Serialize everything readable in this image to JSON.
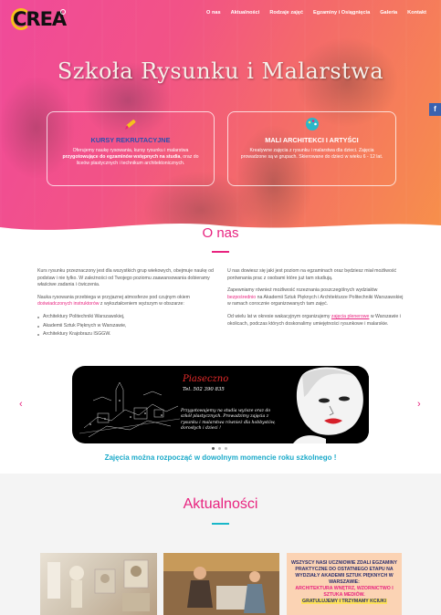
{
  "brand": {
    "logo_text": "CREA"
  },
  "nav": {
    "items": [
      "O nas",
      "Aktualności",
      "Rodzaje zajęć",
      "Egzaminy i Osiągnięcia",
      "Galeria",
      "Kontakt"
    ]
  },
  "social": {
    "facebook_label": "f"
  },
  "hero": {
    "title": "Szkoła Rysunku i Malarstwa",
    "card1": {
      "title": "KURSY REKRUTACYJNE",
      "text_a": "Oferujemy naukę rysowania, kursy rysunku i malarstwa ",
      "text_bold": "przygotowujące do egzaminów wstępnych na studia",
      "text_b": ", oraz do liceów plastycznych i technikum architektonicznych."
    },
    "card2": {
      "title": "MALI ARCHITEKCI I ARTYŚCI",
      "text": "Kreatywne zajęcia z rysunku i malarstwa dla dzieci. Zajęcia prowadzone są w grupach. Skierowane do dzieci w wieku 6 - 12 lat."
    }
  },
  "about": {
    "title": "O nas",
    "left_p1": "Kurs rysunku przeznaczony jest dla wszystkich grup wiekowych, obejmuje naukę od podstaw i nie tylko. W zależności od Twojego poziomu zaawansowania dobieramy właściwe zadania i ćwiczenia.",
    "left_p2a": "Nauka rysowania przebiega w przyjaznej atmosferze pod czujnym okiem ",
    "left_p2_link": "doświadczonych instruktorów",
    "left_p2b": " z wykształceniem wyższym w obszarze:",
    "list": [
      "Architektury Politechniki Warszawskiej,",
      "Akademii Sztuk Pięknych w Warszawie,",
      "Architektury Krajobrazu ISGGW."
    ],
    "right_p1": "U nas dowiesz się jaki jest poziom na egzaminach oraz będziesz miał możliwość porównania  prac z osobami które już tam studiują.",
    "right_p2a": "Zapewniamy również możliwość rozeznania poszczególnych wydziałów ",
    "right_p2_link": "bezpośrednio",
    "right_p2b": " na Akademii Sztuk Pięknych  i Architekturze Politechniki Warszawskiej  w ramach corocznie organizowanych tam zajęć.",
    "right_p3a": "Od wielu lat w okresie wakacyjnym organizujemy ",
    "right_p3_link": "zajęcia plenerowe",
    "right_p3b": " w Warszawie i okolicach,  podczas których doskonalimy umiejętności rysunkowe i malarskie."
  },
  "slider": {
    "prev": "‹",
    "next": "›",
    "place": "Piaseczno",
    "phone": "Tel. 502 390 835",
    "text": "Przygotowujemy na studia wyższe oraz do szkół plastycznych. Prowadzimy zajęcia z rysunku i malarstwa również dla hobbystów, dorosłych i dzieci !",
    "slogan": "Zajęcia można rozpocząć w dowolnym momencie roku szkolnego !",
    "active_slide": 1,
    "slide_count": 3
  },
  "news": {
    "title": "Aktualności",
    "tile3": {
      "line1": "WSZYSCY NASI UCZNIOWIE ZDALI EGZAMINY PRAKTYCZNE DO OSTATNIEGO ETAPU NA WYDZIAŁY AKADEMII SZTUK PIĘKNYCH W WARSZAWIE:",
      "line2": "ARCHITEKTURA WNĘTRZ, WZORNICTWO I SZTUKA MEDIÓW.",
      "line3": "GRATULUJEMY I TRZYMAMY KCIUKI"
    }
  },
  "colors": {
    "accent": "#e8237f",
    "cyan": "#19b7c9",
    "hero_from": "#f04a9a",
    "hero_to": "#f7904a"
  }
}
